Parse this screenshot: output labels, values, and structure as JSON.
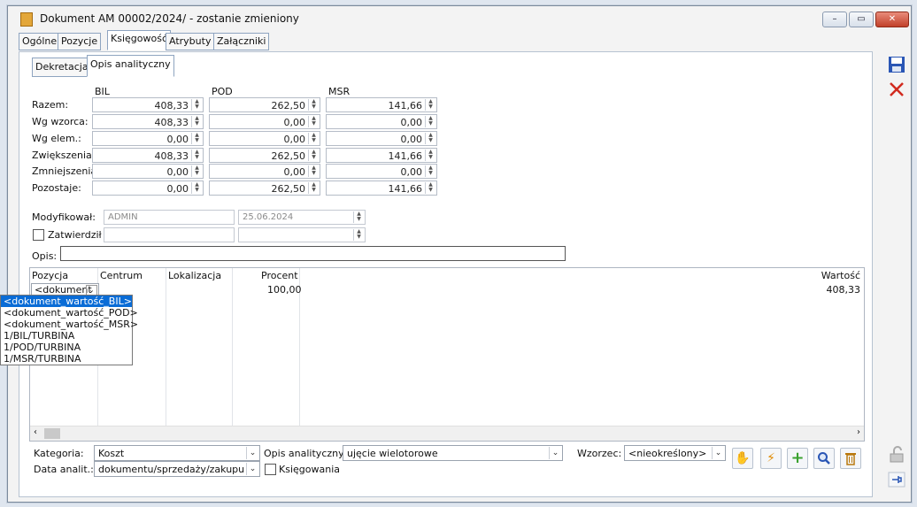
{
  "window": {
    "title": "Dokument AM  00002/2024/ - zostanie zmieniony",
    "min": "–",
    "max": "▭",
    "close": "✕"
  },
  "tabs": [
    "Ogólne",
    "Pozycje",
    "Księgowość",
    "Atrybuty",
    "Załączniki"
  ],
  "subtabs": [
    "Dekretacja",
    "Opis analityczny"
  ],
  "summary": {
    "columns": [
      "BIL",
      "POD",
      "MSR"
    ],
    "rows": [
      {
        "label": "Razem:",
        "values": [
          "408,33",
          "262,50",
          "141,66"
        ]
      },
      {
        "label": "Wg wzorca:",
        "values": [
          "408,33",
          "0,00",
          "0,00"
        ]
      },
      {
        "label": "Wg elem.:",
        "values": [
          "0,00",
          "0,00",
          "0,00"
        ]
      },
      {
        "label": "Zwiększenia:",
        "values": [
          "408,33",
          "262,50",
          "141,66"
        ]
      },
      {
        "label": "Zmniejszenia:",
        "values": [
          "0,00",
          "0,00",
          "0,00"
        ]
      },
      {
        "label": "Pozostaje:",
        "values": [
          "0,00",
          "262,50",
          "141,66"
        ]
      }
    ]
  },
  "modified": {
    "label": "Modyfikował:",
    "user": "ADMIN",
    "date": "25.06.2024"
  },
  "approved": {
    "label": "Zatwierdził"
  },
  "opis": {
    "label": "Opis:",
    "value": ""
  },
  "grid": {
    "headers": [
      "Pozycja",
      "Centrum",
      "Lokalizacja",
      "Procent",
      "Wartość"
    ],
    "row": {
      "pozycja": "<dokument",
      "procent": "100,00",
      "wartosc": "408,33"
    }
  },
  "dropdown": [
    "<dokument_wartość_BIL>",
    "<dokument_wartość_POD>",
    "<dokument_wartość_MSR>",
    "1/BIL/TURBINA",
    "1/POD/TURBINA",
    "1/MSR/TURBINA"
  ],
  "bottom": {
    "kategoria_label": "Kategoria:",
    "kategoria": "Koszt",
    "data_label": "Data analit.:",
    "data": "dokumentu/sprzedaży/zakupu",
    "opis_label": "Opis analityczny:",
    "opis_value": "ujęcie wielotorowe",
    "ksiegowania": "Księgowania",
    "wzorzec_label": "Wzorzec:",
    "wzorzec": "<nieokreślony>"
  },
  "colors": {
    "accent": "#0a6cd6",
    "close": "#c1412b",
    "add": "#3aa12f"
  }
}
